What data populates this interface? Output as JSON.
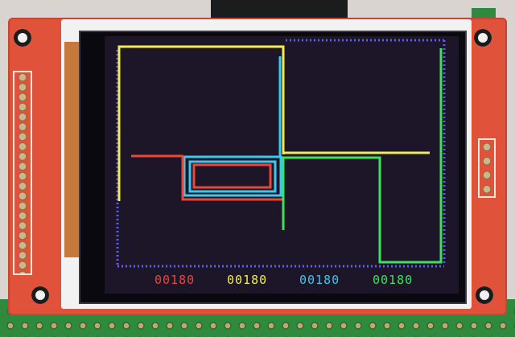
{
  "display": {
    "colors": {
      "red": "#e8473a",
      "yellow": "#f1ee4a",
      "cyan": "#39c8ee",
      "green": "#3be25a",
      "blue_dots": "#5a5ee8"
    },
    "counters": [
      {
        "value": "00180",
        "color": "#e8473a"
      },
      {
        "value": "00180",
        "color": "#f1ee4a"
      },
      {
        "value": "00180",
        "color": "#39c8ee"
      },
      {
        "value": "00180",
        "color": "#3be25a"
      }
    ]
  }
}
